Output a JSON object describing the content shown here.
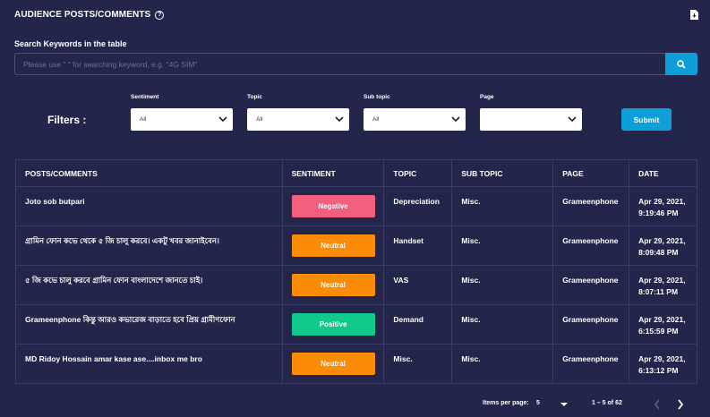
{
  "header": {
    "title": "AUDIENCE POSTS/COMMENTS",
    "help_glyph": "?"
  },
  "search": {
    "label": "Search Keywords in the table",
    "placeholder": "Please use \" \" for searching keyword, e.g. \"4G SIM\""
  },
  "filters": {
    "label": "Filters :",
    "sentiment": {
      "label": "Sentiment",
      "value": "All"
    },
    "topic": {
      "label": "Topic",
      "value": "All"
    },
    "subtopic": {
      "label": "Sub topic",
      "value": "All"
    },
    "page": {
      "label": "Page",
      "value": ""
    },
    "submit_label": "Submit"
  },
  "table": {
    "headers": [
      "POSTS/COMMENTS",
      "SENTIMENT",
      "TOPIC",
      "SUB TOPIC",
      "PAGE",
      "DATE"
    ],
    "rows": [
      {
        "post": "Joto sob butpari",
        "sentiment": "Negative",
        "topic": "Depreciation",
        "subtopic": "Misc.",
        "page": "Grameenphone",
        "date": "Apr 29, 2021, 9:19:46 PM"
      },
      {
        "post": "গ্রামিন ফোন কভে থেকে ৫ জি চালু করবে। একটু খবর জানাইবেন।",
        "sentiment": "Neutral",
        "topic": "Handset",
        "subtopic": "Misc.",
        "page": "Grameenphone",
        "date": "Apr 29, 2021, 8:09:48 PM"
      },
      {
        "post": "৫ জি কভে চালু করবে গ্রামিন ফোন বাংলাদেশে জানতে চাই।",
        "sentiment": "Neutral",
        "topic": "VAS",
        "subtopic": "Misc.",
        "page": "Grameenphone",
        "date": "Apr 29, 2021, 8:07:11 PM"
      },
      {
        "post": "Grameenphone কিন্তু আরও কভারেজ বাড়াতে হবে প্রিয় গ্রামীণফোন",
        "sentiment": "Positive",
        "topic": "Demand",
        "subtopic": "Misc.",
        "page": "Grameenphone",
        "date": "Apr 29, 2021, 6:15:59 PM"
      },
      {
        "post": "MD Ridoy Hossain amar kase ase....inbox me bro",
        "sentiment": "Neutral",
        "topic": "Misc.",
        "subtopic": "Misc.",
        "page": "Grameenphone",
        "date": "Apr 29, 2021, 6:13:12 PM"
      }
    ]
  },
  "pagination": {
    "items_per_page_label": "Items per page:",
    "items_per_page_value": "5",
    "range_label": "1 – 5 of 62"
  },
  "colors": {
    "background": "#23264a",
    "accent": "#0e9fd8",
    "negative": "#f2607e",
    "neutral": "#fb8c08",
    "positive": "#11c98a"
  }
}
